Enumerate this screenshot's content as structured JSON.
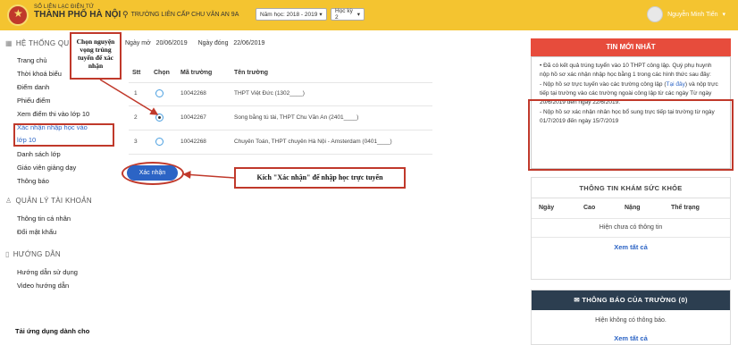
{
  "header": {
    "brand_small": "SỔ LIÊN LẠC ĐIỆN TỬ",
    "brand_big": "THÀNH PHỐ HÀ NỘI",
    "school": "TRƯỜNG LIÊN CẤP CHU VĂN AN  9A",
    "year_select": "Năm học: 2018 - 2019",
    "term_select": "Học kỳ 2",
    "user_name": "Nguyễn Minh Tiến"
  },
  "sidebar": {
    "section1": "HỆ THỐNG QU",
    "items": [
      "Trang chủ",
      "Thời khoá biểu",
      "Điểm danh",
      "Phiếu điểm",
      "Xem điểm thi vào lớp 10",
      "Xác nhận nhập học vào",
      "lớp 10",
      "Danh sách lớp",
      "Giáo viên giảng dạy",
      "Thông báo"
    ],
    "section2": "QUẢN LÝ TÀI KHOẢN",
    "items2": [
      "Thông tin cá nhân",
      "Đổi mật khẩu"
    ],
    "section3": "HƯỚNG DẪN",
    "items3": [
      "Hướng dẫn sử dụng",
      "Video hướng dẫn"
    ],
    "footer": "Tải ứng dụng dành cho"
  },
  "main": {
    "open_label": "Ngày mở",
    "open_date": "20/06/2019",
    "close_label": "Ngày đóng",
    "close_date": "22/06/2019",
    "columns": [
      "Stt",
      "Chọn",
      "Mã trường",
      "Tên trường"
    ],
    "rows": [
      {
        "stt": "1",
        "code": "10042268",
        "name": "THPT Việt Đức (1302____)"
      },
      {
        "stt": "2",
        "code": "10042267",
        "name": "Song bằng tú tài, THPT Chu Văn An (2401____)"
      },
      {
        "stt": "3",
        "code": "10042268",
        "name": "Chuyên Toán, THPT chuyên Hà Nội - Amsterdam (0401____)"
      }
    ],
    "selected_row": 2,
    "confirm_label": "Xác nhận"
  },
  "news": {
    "title": "TIN MỚI NHẤT",
    "p1": "• Đã có kết quả trúng tuyển vào 10 THPT công lập. Quý phụ huynh nộp hồ sơ xác nhận nhập học bằng 1 trong các hình thức sau đây:",
    "p2a": "-    Nộp hồ sơ trực tuyến vào các trường công lập (",
    "p2link": "Tại đây",
    "p2b": ") và nộp trực tiếp tại trường vào các trường ngoài công lập từ các ngày Từ ngày 20/6/2019 đến ngày 22/6/2019.",
    "p3": "-    Nộp hồ sơ xác nhận nhân học bổ sung trực tiếp tại trường từ ngày 01/7/2019 đến ngày 15/7/2019"
  },
  "health": {
    "title": "THÔNG TIN KHÁM SỨC KHỎE",
    "columns": [
      "Ngày",
      "Cao",
      "Nặng",
      "Thể trạng"
    ],
    "empty": "Hiện chưa có thông tin",
    "more": "Xem tất cả"
  },
  "school_news": {
    "title": "THÔNG BÁO CỦA TRƯỜNG (0)",
    "empty": "Hiện không có thông báo.",
    "more": "Xem tất cả"
  },
  "annotations": {
    "note1": "Chọn nguyện vọng trúng tuyển để xác nhận",
    "note2": "Kích \"Xác nhận\" để nhập học trực tuyến"
  },
  "colors": {
    "topbar": "#f4c430",
    "accent_red": "#e74c3c",
    "button_blue": "#2c64c5",
    "dark_header": "#2c3e50"
  }
}
